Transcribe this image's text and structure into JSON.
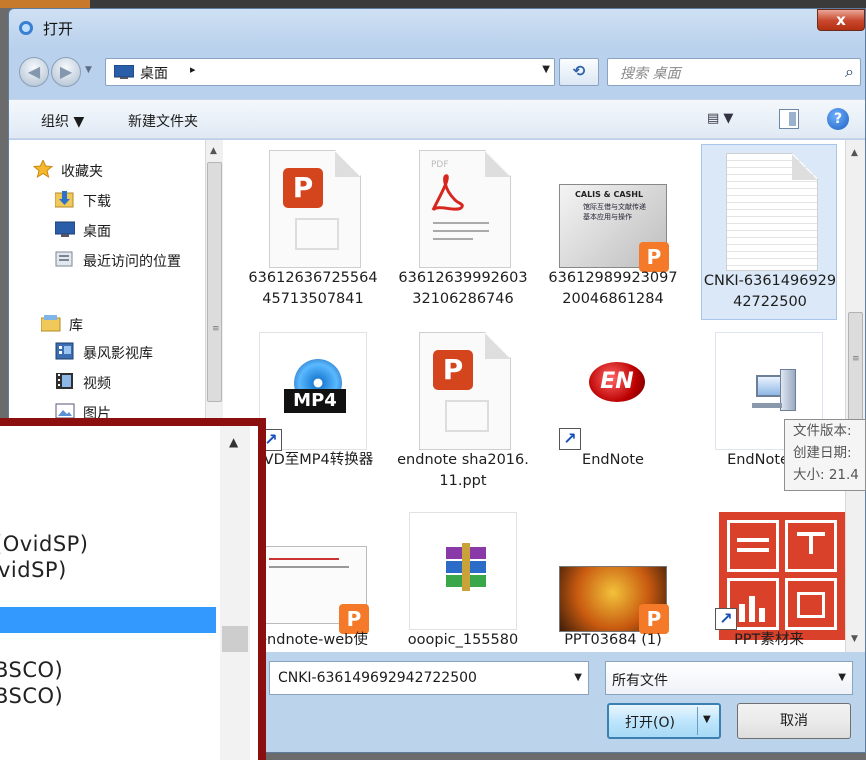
{
  "window": {
    "title": "打开",
    "close_glyph": "x"
  },
  "nav": {
    "back_glyph": "◀",
    "forward_glyph": "▶",
    "address_text": "桌面",
    "address_arrow": "▸",
    "dropdown_glyph": "▼",
    "refresh_glyph": "⟲",
    "search_placeholder": "搜索 桌面",
    "search_glyph": "⌕"
  },
  "toolbar": {
    "organize_label": "组织 ▼",
    "new_folder_label": "新建文件夹",
    "view_glyph": "▤ ▼",
    "help_glyph": "?"
  },
  "sidebar": {
    "items": [
      {
        "label": "收藏夹",
        "icon": "star-icon"
      },
      {
        "label": "下载",
        "icon": "download-folder-icon"
      },
      {
        "label": "桌面",
        "icon": "desktop-icon"
      },
      {
        "label": "最近访问的位置",
        "icon": "recent-places-icon"
      },
      {
        "label": "库",
        "icon": "library-icon"
      },
      {
        "label": "暴风影视库",
        "icon": "media-library-icon"
      },
      {
        "label": "视频",
        "icon": "video-icon"
      },
      {
        "label": "图片",
        "icon": "pictures-icon"
      }
    ]
  },
  "files": [
    {
      "name": "6361263672556445713507841",
      "icon": "wps-presentation-icon"
    },
    {
      "name": "6361263999260332106286746",
      "icon": "pdf-icon",
      "badge": "PDF"
    },
    {
      "name": "6361298992309720046861284",
      "icon": "presentation-thumbnail-icon",
      "thumb_lines": [
        "CALIS & CASHL",
        "馆际互借与文献传递",
        "基本应用与操作"
      ]
    },
    {
      "name": "CNKI-636149692942722500",
      "icon": "text-document-icon",
      "selected": true
    },
    {
      "name": "DVD至MP4转换器",
      "icon": "mp4-converter-shortcut-icon",
      "badge": "MP4"
    },
    {
      "name": "endnote sha2016.11.ppt",
      "icon": "wps-presentation-icon"
    },
    {
      "name": "EndNote",
      "icon": "endnote-shortcut-icon",
      "badge": "EN"
    },
    {
      "name": "EndNotePlu",
      "icon": "endnote-plugin-icon"
    },
    {
      "name": "endnote-web使",
      "icon": "presentation-thumbnail-icon"
    },
    {
      "name": "ooopic_155580",
      "icon": "winrar-archive-icon"
    },
    {
      "name": "PPT03684 (1)",
      "icon": "presentation-thumbnail-icon"
    },
    {
      "name": "PPT素材来",
      "icon": "ppt-materials-shortcut-icon"
    }
  ],
  "wps_glyph": "P",
  "shortcut_glyph": "↗",
  "tooltip": {
    "lines": [
      "文件版本:",
      "创建日期:",
      "大小: 21.4"
    ]
  },
  "footer": {
    "filename_value": "CNKI-636149692942722500",
    "filetype_value": "所有文件",
    "open_label": "打开(O)",
    "cancel_label": "取消"
  },
  "overlay": {
    "lines": [
      "(OvidSP)",
      "vidSP)",
      "BSCO)",
      "BSCO)"
    ],
    "scroll_up_glyph": "▲"
  }
}
